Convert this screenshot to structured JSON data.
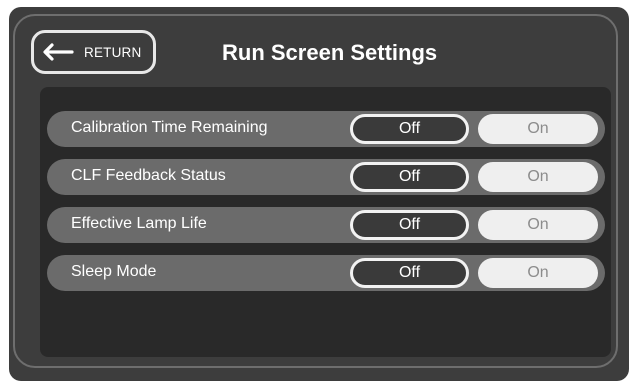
{
  "header": {
    "return_label": "RETURN",
    "title": "Run Screen Settings"
  },
  "settings": [
    {
      "label": "Calibration Time Remaining",
      "off_label": "Off",
      "on_label": "On",
      "selected": "Off"
    },
    {
      "label": "CLF Feedback Status",
      "off_label": "Off",
      "on_label": "On",
      "selected": "Off"
    },
    {
      "label": "Effective Lamp Life",
      "off_label": "Off",
      "on_label": "On",
      "selected": "Off"
    },
    {
      "label": "Sleep Mode",
      "off_label": "Off",
      "on_label": "On",
      "selected": "Off"
    }
  ],
  "colors": {
    "background": "#3d3d3d",
    "panel": "#292929",
    "row": "#6b6b6b",
    "selected_toggle_border": "#f2f2f2",
    "unselected_toggle": "#efefef"
  },
  "icons": {
    "return": "return-arrow-icon"
  }
}
